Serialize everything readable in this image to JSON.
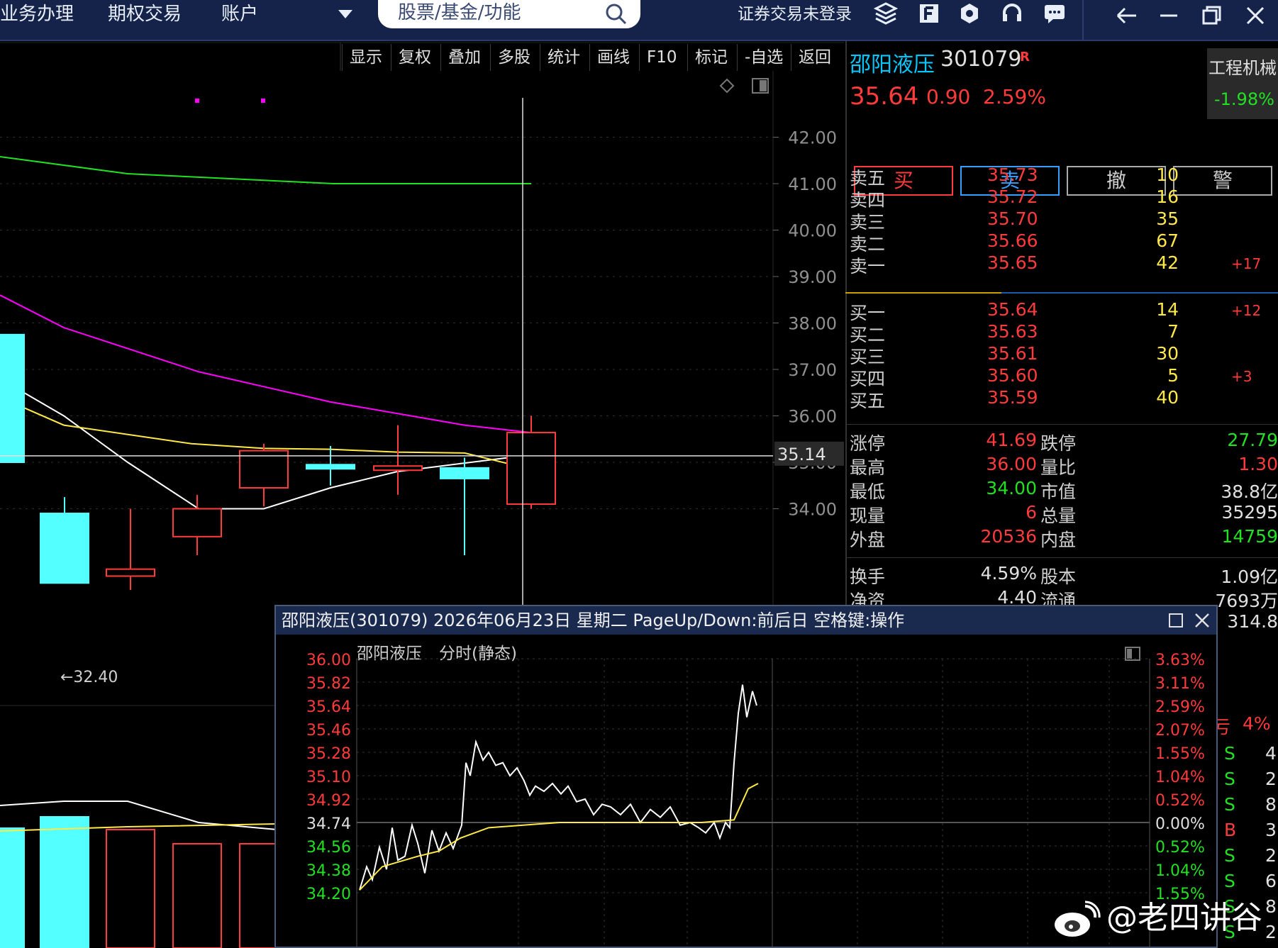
{
  "menu": {
    "items": [
      "业务办理",
      "期权交易",
      "账户"
    ],
    "search_placeholder": "股票/基金/功能",
    "login_status": "证券交易未登录"
  },
  "toolbar": [
    "显示",
    "复权",
    "叠加",
    "多股",
    "统计",
    "画线",
    "F10",
    "标记",
    "-自选",
    "返回"
  ],
  "kline": {
    "price_axis": [
      "42.00",
      "41.00",
      "40.00",
      "39.00",
      "38.00",
      "37.00",
      "36.00",
      "35.00",
      "34.00"
    ],
    "cursor_price": "35.14",
    "low_marker": "←32.40",
    "candles": [
      {
        "o": 37.75,
        "c": 35.0,
        "h": 37.75,
        "l": 35.0,
        "dir": "down"
      },
      {
        "o": 33.9,
        "c": 32.4,
        "h": 34.25,
        "l": 32.4,
        "dir": "down"
      },
      {
        "o": 32.7,
        "c": 32.55,
        "h": 34.0,
        "l": 32.25,
        "dir": "up"
      },
      {
        "o": 33.4,
        "c": 34.0,
        "h": 34.3,
        "l": 33.0,
        "dir": "up"
      },
      {
        "o": 34.45,
        "c": 35.25,
        "h": 35.4,
        "l": 34.05,
        "dir": "up"
      },
      {
        "o": 34.95,
        "c": 34.88,
        "h": 35.35,
        "l": 34.5,
        "dir": "down"
      },
      {
        "o": 34.92,
        "c": 34.85,
        "h": 35.8,
        "l": 34.3,
        "dir": "up"
      },
      {
        "o": 34.88,
        "c": 34.65,
        "h": 35.1,
        "l": 33.0,
        "dir": "down"
      },
      {
        "o": 34.1,
        "c": 35.64,
        "h": 36.0,
        "l": 34.0,
        "dir": "up"
      }
    ],
    "ma_white": [
      36.8,
      36.0,
      35.0,
      34.0,
      34.0,
      34.45,
      34.8,
      35.14
    ],
    "ma_yellow": [
      36.4,
      35.8,
      35.4,
      35.3,
      35.28,
      35.22,
      35.2,
      34.85
    ],
    "ma_magenta": [
      38.6,
      37.9,
      36.95,
      36.3,
      35.8,
      35.64
    ],
    "ma_green": 41.0
  },
  "quote": {
    "name": "邵阳液压",
    "code": "301079",
    "r_mark": "R",
    "price": "35.64",
    "change": "0.90",
    "change_pct": "2.59%",
    "sector": "工程机械",
    "sector_pct": "-1.98%",
    "buttons": [
      "买",
      "卖",
      "撤",
      "警"
    ],
    "asks": [
      {
        "label": "卖五",
        "price": "35.73",
        "vol": "10",
        "extra": ""
      },
      {
        "label": "卖四",
        "price": "35.72",
        "vol": "16",
        "extra": ""
      },
      {
        "label": "卖三",
        "price": "35.70",
        "vol": "35",
        "extra": ""
      },
      {
        "label": "卖二",
        "price": "35.66",
        "vol": "67",
        "extra": ""
      },
      {
        "label": "卖一",
        "price": "35.65",
        "vol": "42",
        "extra": "+17"
      }
    ],
    "bids": [
      {
        "label": "买一",
        "price": "35.64",
        "vol": "14",
        "extra": "+12"
      },
      {
        "label": "买二",
        "price": "35.63",
        "vol": "7",
        "extra": ""
      },
      {
        "label": "买三",
        "price": "35.61",
        "vol": "30",
        "extra": ""
      },
      {
        "label": "买四",
        "price": "35.60",
        "vol": "5",
        "extra": "+3"
      },
      {
        "label": "买五",
        "price": "35.59",
        "vol": "40",
        "extra": ""
      }
    ],
    "stats": [
      {
        "l1": "涨停",
        "v1": "41.69",
        "l2": "跌停",
        "v2": "27.79"
      },
      {
        "l1": "最高",
        "v1": "36.00",
        "l2": "量比",
        "v2": "1.30"
      },
      {
        "l1": "最低",
        "v1": "34.00",
        "l2": "市值",
        "v2": "38.8亿"
      },
      {
        "l1": "现量",
        "v1": "6",
        "l2": "总量",
        "v2": "35295"
      },
      {
        "l1": "外盘",
        "v1": "20536",
        "l2": "内盘",
        "v2": "14759"
      }
    ],
    "stats2": [
      {
        "l1": "换手",
        "v1": "4.59%",
        "l2": "股本",
        "v2": "1.09亿"
      },
      {
        "l1": "净资",
        "v1": "4.40",
        "l2": "流通",
        "v2": "7693万"
      },
      {
        "l1": "",
        "v1": "",
        "l2": "",
        "v2": "314.8"
      }
    ],
    "ticks_header": [
      "亏",
      "4%"
    ],
    "ticks": [
      "S",
      "S",
      "S",
      "B",
      "S",
      "S",
      "S",
      "S"
    ],
    "ticks_right": [
      "4",
      "2",
      "8",
      "3",
      "2",
      "6",
      "8",
      "2"
    ]
  },
  "popup": {
    "title": "邵阳液压(301079) 2026年06月23日 星期二 PageUp/Down:前后日 空格键:操作",
    "subtitle_name": "邵阳液压",
    "subtitle_mode": "分时(静态)",
    "price_labels": [
      "36.00",
      "35.82",
      "35.64",
      "35.46",
      "35.28",
      "35.10",
      "34.92",
      "34.74",
      "34.56",
      "34.38",
      "34.20"
    ],
    "pct_labels": [
      "3.63%",
      "3.11%",
      "2.59%",
      "2.07%",
      "1.55%",
      "1.04%",
      "0.52%",
      "0.00%",
      "0.52%",
      "1.04%",
      "1.55%"
    ],
    "prev_close": 34.74
  },
  "watermark": "@老四讲谷",
  "colors": {
    "up": "#ff3b3b",
    "down": "#54ffff",
    "accent_blue": "#00c8ff",
    "yellow": "#ffe94a",
    "green": "#22e022"
  }
}
